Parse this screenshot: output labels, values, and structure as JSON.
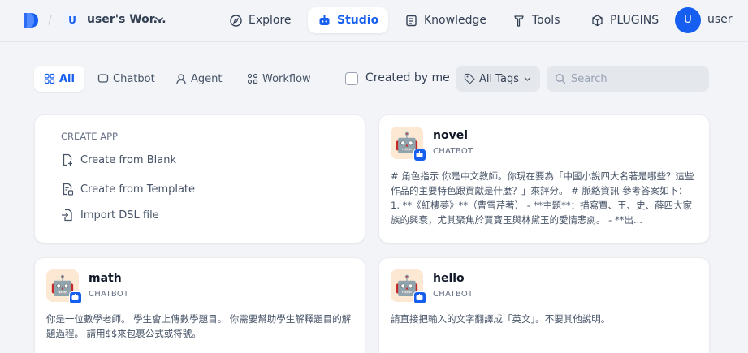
{
  "header": {
    "workspace_initial": "U",
    "workspace_name": "user's Wor...",
    "nav": {
      "explore": "Explore",
      "studio": "Studio",
      "knowledge": "Knowledge",
      "tools": "Tools",
      "plugins": "PLUGINS"
    },
    "user_initial": "U",
    "user_name": "user"
  },
  "filters": {
    "tabs": {
      "all": "All",
      "chatbot": "Chatbot",
      "agent": "Agent",
      "workflow": "Workflow"
    },
    "created_by_me": "Created by me",
    "created_by_me_checked": false,
    "all_tags": "All Tags",
    "search_placeholder": "Search",
    "search_value": ""
  },
  "create_app": {
    "title": "CREATE APP",
    "from_blank": "Create from Blank",
    "from_template": "Create from Template",
    "import_dsl": "Import DSL file"
  },
  "apps": [
    {
      "name": "novel",
      "type": "CHATBOT",
      "icon": "robot-emoji",
      "description": "# 角色指示 你是中文教師。你現在要為「中國小說四大名著是哪些？這些作品的主要特色跟貢獻是什麼？」來評分。 # 脈絡資訊 參考答案如下： 1. **《紅樓夢》**（曹雪芹著） - **主題**：描寫賈、王、史、薛四大家族的興衰，尤其聚焦於賈寶玉與林黛玉的愛情悲劇。 - **出..."
    },
    {
      "name": "math",
      "type": "CHATBOT",
      "icon": "robot-emoji",
      "description": "你是一位數學老師。 學生會上傳數學題目。 你需要幫助學生解釋題目的解題過程。 請用$$來包裹公式或符號。"
    },
    {
      "name": "hello",
      "type": "CHATBOT",
      "icon": "robot-emoji",
      "description": "請直接把輸入的文字翻譯成「英文」。不要其他說明。"
    }
  ],
  "colors": {
    "accent": "#155eef",
    "background": "#f2f4f7",
    "icon_bg": "#fde8d3"
  }
}
